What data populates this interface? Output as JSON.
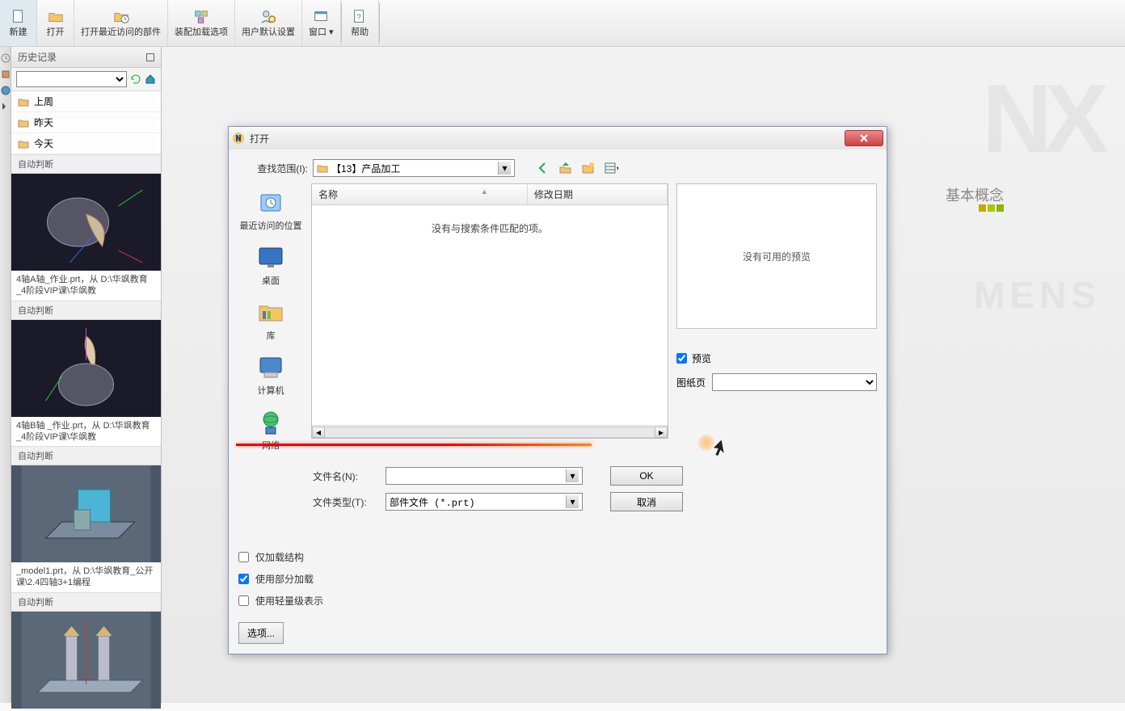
{
  "toolbar": {
    "new": "新建",
    "open": "打开",
    "recent": "打开最近访问的部件",
    "asm_opts": "装配加载选项",
    "user_defaults": "用户默认设置",
    "window": "窗口",
    "help": "帮助"
  },
  "history_panel": {
    "title": "历史记录",
    "folders": {
      "last_week": "上周",
      "yesterday": "昨天",
      "today": "今天"
    },
    "items": [
      {
        "mode": "自动判断",
        "caption": "4轴A轴_作业.prt，从 D:\\华飒教育_4阶段VIP课\\华飒教"
      },
      {
        "mode": "自动判断",
        "caption": "4轴B轴 _作业.prt，从 D:\\华飒教育_4阶段VIP课\\华飒教"
      },
      {
        "mode": "自动判断",
        "caption": "_model1.prt，从 D:\\华飒教育_公开课\\2.4四轴3+1编程"
      },
      {
        "mode": "自动判断",
        "caption": ""
      }
    ]
  },
  "dialog": {
    "title": "打开",
    "lookin_label": "查找范围(I):",
    "lookin_value": "【13】产品加工",
    "columns": {
      "name": "名称",
      "date": "修改日期"
    },
    "empty_text": "没有与搜索条件匹配的项。",
    "places": {
      "recent": "最近访问的位置",
      "desktop": "桌面",
      "library": "库",
      "computer": "计算机",
      "network": "网络"
    },
    "filename_label": "文件名(N):",
    "filetype_label": "文件类型(T):",
    "filetype_value": "部件文件 (*.prt)",
    "ok": "OK",
    "cancel": "取消",
    "preview_empty": "没有可用的预览",
    "preview_chk": "预览",
    "drawsheet_label": "图纸页",
    "opt_load_struct": "仅加载结构",
    "opt_partial": "使用部分加载",
    "opt_lightweight": "使用轻量级表示",
    "options_btn": "选项..."
  },
  "corner_label": "基本概念",
  "watermark": "NX",
  "watermark2": "MENS"
}
